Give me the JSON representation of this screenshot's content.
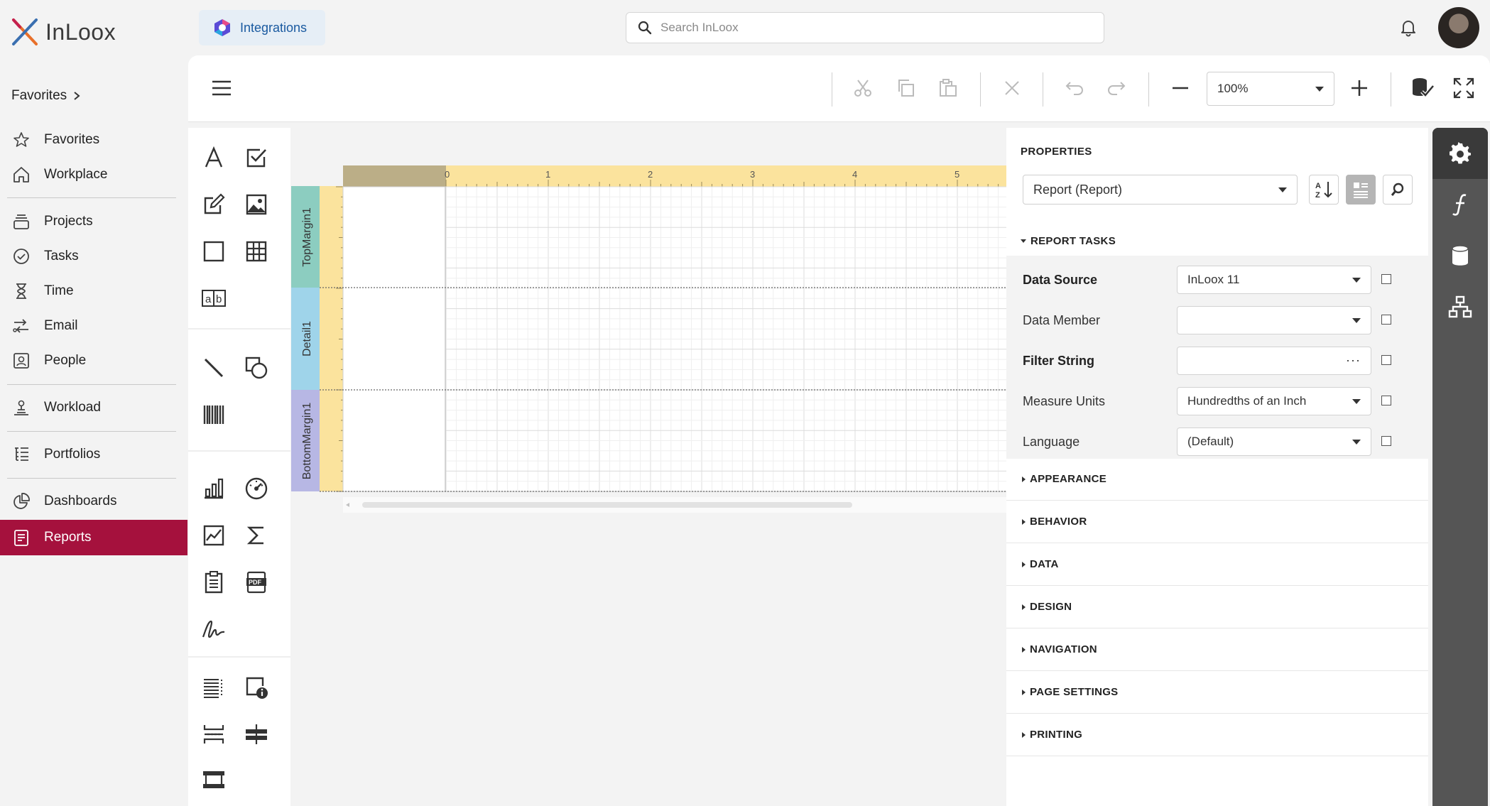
{
  "app": {
    "logo_text": "InLoox",
    "integrations_label": "Integrations",
    "search_placeholder": "Search InLoox"
  },
  "sidebar": {
    "favorites_header": "Favorites",
    "items": [
      {
        "label": "Favorites"
      },
      {
        "label": "Workplace"
      },
      {
        "label": "Projects"
      },
      {
        "label": "Tasks"
      },
      {
        "label": "Time"
      },
      {
        "label": "Email"
      },
      {
        "label": "People"
      },
      {
        "label": "Workload"
      },
      {
        "label": "Portfolios"
      },
      {
        "label": "Dashboards"
      },
      {
        "label": "Reports"
      }
    ],
    "active_color": "#a5113d"
  },
  "toolbar": {
    "zoom": "100%"
  },
  "designer": {
    "bands": [
      "TopMargin1",
      "Detail1",
      "BottomMargin1"
    ],
    "ruler_numbers": [
      "0",
      "1",
      "2",
      "3",
      "4",
      "5"
    ]
  },
  "properties": {
    "title": "PROPERTIES",
    "selected_object": "Report (Report)",
    "tasks_header": "REPORT TASKS",
    "rows": [
      {
        "label": "Data Source",
        "value": "InLoox 11"
      },
      {
        "label": "Data Member",
        "value": ""
      },
      {
        "label": "Filter String",
        "value": ""
      },
      {
        "label": "Measure Units",
        "value": "Hundredths of an Inch"
      },
      {
        "label": "Language",
        "value": "(Default)"
      }
    ],
    "sections": [
      "APPEARANCE",
      "BEHAVIOR",
      "DATA",
      "DESIGN",
      "NAVIGATION",
      "PAGE SETTINGS",
      "PRINTING"
    ]
  }
}
